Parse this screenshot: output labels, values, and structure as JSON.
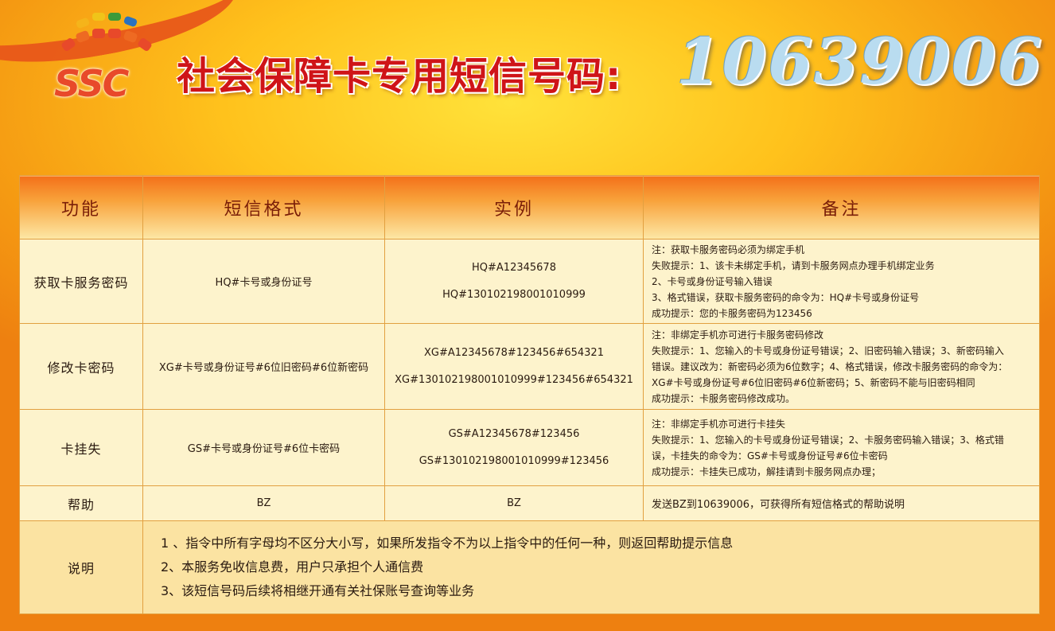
{
  "header": {
    "logo_text": "SSC",
    "title": "社会保障卡专用短信号码:",
    "number": "10639006"
  },
  "colors": {
    "title_red": "#cf1418",
    "number_blue": "#b9dcf0",
    "header_orange": "#f4701a",
    "cell_cream": "#fdf3cc"
  },
  "table": {
    "headers": [
      "功能",
      "短信格式",
      "实例",
      "备注"
    ],
    "rows": [
      {
        "function": "获取卡服务密码",
        "format": "HQ#卡号或身份证号",
        "examples": [
          "HQ#A12345678",
          "HQ#130102198001010999"
        ],
        "notes": [
          "注：获取卡服务密码必须为绑定手机",
          "失败提示：1、该卡未绑定手机，请到卡服务网点办理手机绑定业务",
          "2、卡号或身份证号输入错误",
          "3、格式错误，获取卡服务密码的命令为：HQ#卡号或身份证号",
          "成功提示：您的卡服务密码为123456"
        ]
      },
      {
        "function": "修改卡密码",
        "format": "XG#卡号或身份证号#6位旧密码#6位新密码",
        "examples": [
          "XG#A12345678#123456#654321",
          "XG#130102198001010999#123456#654321"
        ],
        "notes": [
          "注：非绑定手机亦可进行卡服务密码修改",
          "失败提示：1、您输入的卡号或身份证号错误；2、旧密码输入错误；3、新密码输入",
          "错误。建议改为：新密码必须为6位数字；4、格式错误，修改卡服务密码的命令为：",
          "XG#卡号或身份证号#6位旧密码#6位新密码；5、新密码不能与旧密码相同",
          "成功提示：卡服务密码修改成功。"
        ]
      },
      {
        "function": "卡挂失",
        "format": "GS#卡号或身份证号#6位卡密码",
        "examples": [
          "GS#A12345678#123456",
          "GS#130102198001010999#123456"
        ],
        "notes": [
          "注：非绑定手机亦可进行卡挂失",
          "失败提示：1、您输入的卡号或身份证号错误；2、卡服务密码输入错误；3、格式错",
          "误，卡挂失的命令为：GS#卡号或身份证号#6位卡密码",
          "成功提示：卡挂失已成功，解挂请到卡服务网点办理；"
        ]
      }
    ],
    "help_row": {
      "function": "帮助",
      "format": "BZ",
      "example": "BZ",
      "note": "发送BZ到10639006，可获得所有短信格式的帮助说明"
    },
    "explanation": {
      "label": "说明",
      "items": [
        "1 、指令中所有字母均不区分大小写，如果所发指令不为以上指令中的任何一种，则返回帮助提示信息",
        "2、本服务免收信息费，用户只承担个人通信费",
        "3、该短信号码后续将相继开通有关社保账号查询等业务"
      ]
    }
  }
}
